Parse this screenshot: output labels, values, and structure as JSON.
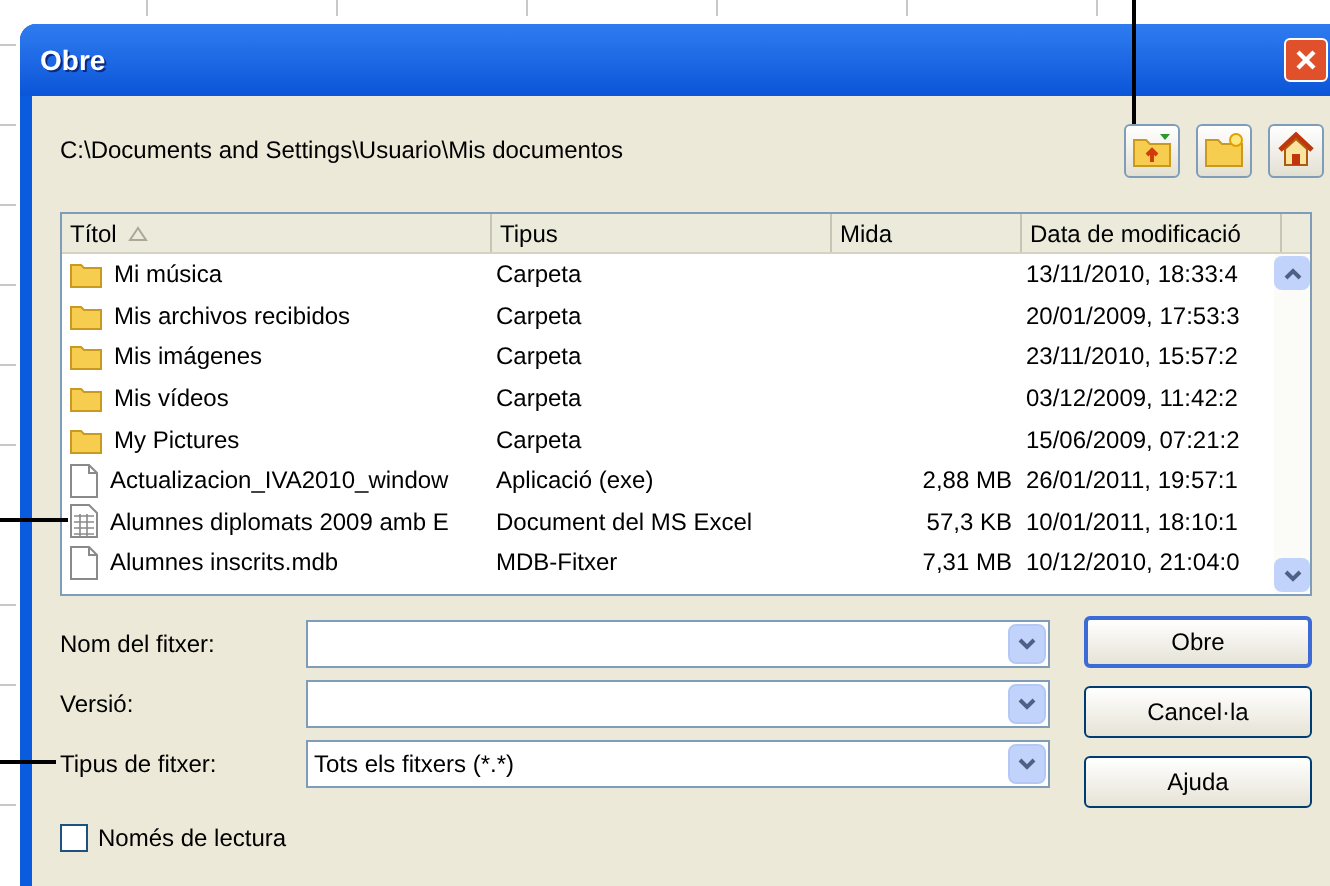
{
  "window": {
    "title": "Obre"
  },
  "path": "C:\\Documents and Settings\\Usuario\\Mis documentos",
  "toolbar": [
    {
      "kind": "up-folder"
    },
    {
      "kind": "new-folder"
    },
    {
      "kind": "home"
    }
  ],
  "file_list": {
    "columns": [
      {
        "label": "Títol",
        "sorted": true
      },
      {
        "label": "Tipus"
      },
      {
        "label": "Mida"
      },
      {
        "label": "Data de modificació"
      }
    ],
    "rows": [
      {
        "kind": "folder",
        "title": "Mi música",
        "type": "Carpeta",
        "modified": "13/11/2010, 18:33:4"
      },
      {
        "kind": "folder",
        "title": "Mis archivos recibidos",
        "type": "Carpeta",
        "modified": "20/01/2009, 17:53:3"
      },
      {
        "kind": "folder",
        "title": "Mis imágenes",
        "type": "Carpeta",
        "modified": "23/11/2010, 15:57:2"
      },
      {
        "kind": "folder",
        "title": "Mis vídeos",
        "type": "Carpeta",
        "modified": "03/12/2009, 11:42:2"
      },
      {
        "kind": "folder",
        "title": "My Pictures",
        "type": "Carpeta",
        "modified": "15/06/2009, 07:21:2"
      },
      {
        "kind": "file",
        "title": "Actualizacion_IVA2010_window",
        "type": "Aplicació (exe)",
        "size": "2,88 MB",
        "modified": "26/01/2011, 19:57:1"
      },
      {
        "kind": "spreadsheet",
        "title": "Alumnes diplomats 2009 amb E",
        "type": "Document del MS Excel",
        "size": "57,3 KB",
        "modified": "10/01/2011, 18:10:1"
      },
      {
        "kind": "file",
        "title": "Alumnes inscrits.mdb",
        "type": "MDB-Fitxer",
        "size": "7,31 MB",
        "modified": "10/12/2010, 21:04:0"
      }
    ]
  },
  "fields": [
    {
      "label": "Nom del fitxer:"
    },
    {
      "label": "Versió:"
    },
    {
      "label": "Tipus de fitxer:",
      "value": "Tots els fitxers (*.*)"
    }
  ],
  "buttons": [
    {
      "label": "Obre",
      "default": true
    },
    {
      "label": "Cancel·la",
      "default": false
    },
    {
      "label": "Ajuda",
      "default": false
    }
  ],
  "read_only": {
    "label": "Només de lectura",
    "checked": false
  }
}
